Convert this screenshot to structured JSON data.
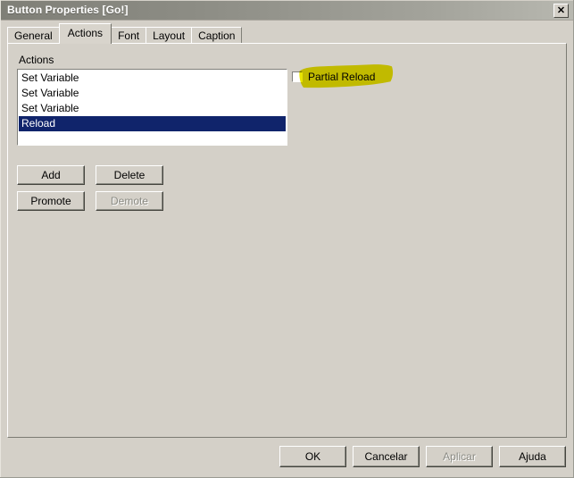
{
  "window": {
    "title": "Button Properties [Go!]",
    "close_icon": "close-icon",
    "close_glyph": "✕"
  },
  "tabs": [
    {
      "label": "General",
      "selected": false
    },
    {
      "label": "Actions",
      "selected": true
    },
    {
      "label": "Font",
      "selected": false
    },
    {
      "label": "Layout",
      "selected": false
    },
    {
      "label": "Caption",
      "selected": false
    }
  ],
  "actions_panel": {
    "group_label": "Actions",
    "list_items": [
      {
        "label": "Set Variable",
        "selected": false
      },
      {
        "label": "Set Variable",
        "selected": false
      },
      {
        "label": "Set Variable",
        "selected": false
      },
      {
        "label": "Reload",
        "selected": true
      }
    ],
    "buttons": [
      {
        "id": "add",
        "label": "Add",
        "disabled": false
      },
      {
        "id": "delete",
        "label": "Delete",
        "disabled": false
      },
      {
        "id": "promote",
        "label": "Promote",
        "disabled": false
      },
      {
        "id": "demote",
        "label": "Demote",
        "disabled": true
      }
    ],
    "partial_reload": {
      "label": "Partial Reload",
      "checked": false,
      "highlighted": true,
      "highlight_color": "#e8e400"
    }
  },
  "dialog_buttons": [
    {
      "id": "ok",
      "label": "OK",
      "disabled": false
    },
    {
      "id": "cancel",
      "label": "Cancelar",
      "disabled": false
    },
    {
      "id": "apply",
      "label": "Aplicar",
      "disabled": true
    },
    {
      "id": "help",
      "label": "Ajuda",
      "disabled": false
    }
  ],
  "colors": {
    "dialog_face": "#d4d0c8",
    "selection": "#10246b",
    "titlebar_start": "#7f7f77",
    "titlebar_end": "#b8b8b0"
  }
}
